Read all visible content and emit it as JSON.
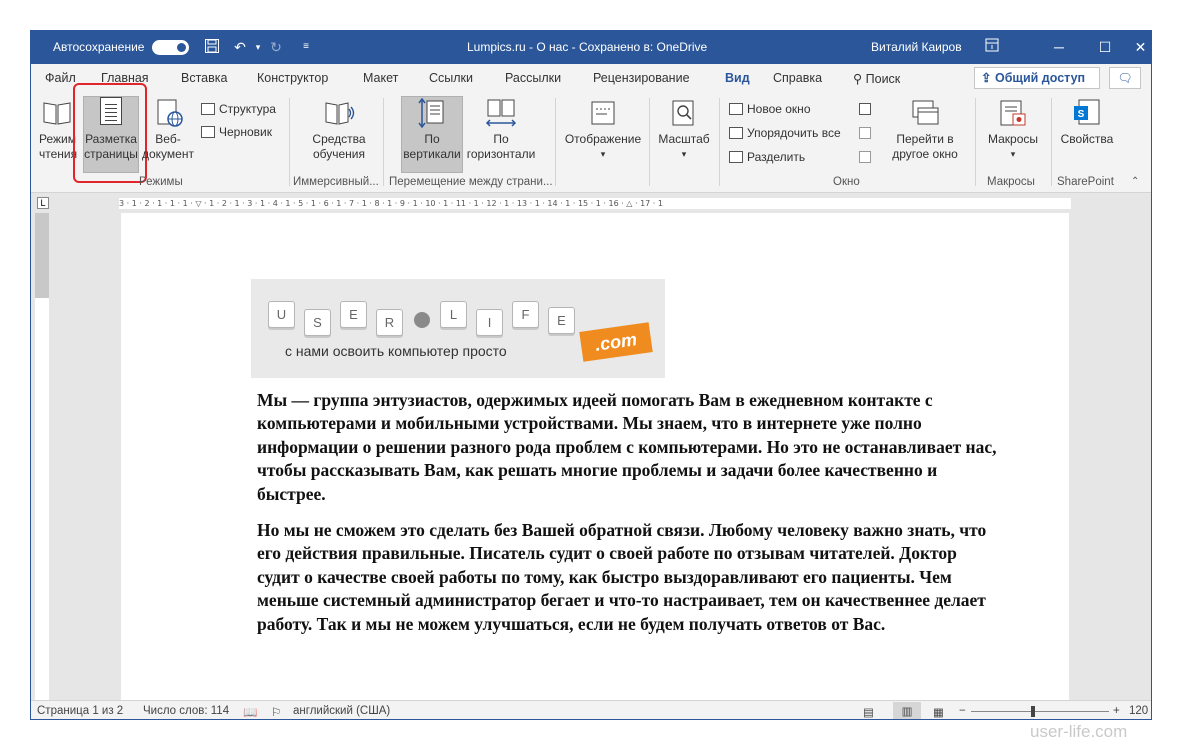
{
  "titlebar": {
    "autosave_label": "Автосохранение",
    "title": "Lumpics.ru - О нас - Сохранено в: OneDrive",
    "user": "Виталий Каиров",
    "controls": [
      "─",
      "☐",
      "✕"
    ]
  },
  "tabs": {
    "items": [
      "Файл",
      "Главная",
      "Вставка",
      "Конструктор",
      "Макет",
      "Ссылки",
      "Рассылки",
      "Рецензирование",
      "Вид",
      "Справка",
      "Поиск"
    ],
    "active": "Вид",
    "share_label": "Общий доступ"
  },
  "ribbon": {
    "modes": {
      "read_mode": "Режим чтения",
      "print_layout": "Разметка страницы",
      "web_layout": "Веб-документ",
      "outline": "Структура",
      "draft": "Черновик",
      "group_label": "Режимы"
    },
    "immersive": {
      "learning_tools": "Средства обучения",
      "group_label": "Иммерсивный..."
    },
    "page_movement": {
      "vertical": "По вертикали",
      "side_to_side": "По горизонтали",
      "group_label": "Перемещение между страни..."
    },
    "show": {
      "label": "Отображение"
    },
    "zoom": {
      "label": "Масштаб"
    },
    "window": {
      "new_window": "Новое окно",
      "arrange_all": "Упорядочить все",
      "split": "Разделить",
      "switch_windows": "Перейти в другое окно",
      "group_label": "Окно"
    },
    "macros": {
      "label": "Макросы",
      "group_label": "Макросы"
    },
    "sharepoint": {
      "label": "Свойства",
      "group_label": "SharePoint"
    }
  },
  "ruler": {
    "marks": "3 · 1 · 2 · 1 · 1 · 1 · ▽ · 1 · 2 · 1 · 3 · 1 · 4 · 1 · 5 · 1 · 6 · 1 · 7 · 1 · 8 · 1 · 9 · 1 · 10 · 1 · 11 · 1 · 12 · 1 · 13 · 1 · 14 · 1 · 15 · 1 · 16 · △ · 17 · 1"
  },
  "document": {
    "logo": {
      "keys": [
        "U",
        "S",
        "E",
        "R",
        "L",
        "I",
        "F",
        "E"
      ],
      "slogan": "с нами освоить компьютер просто",
      "domain": ".com"
    },
    "paragraph1": "Мы — группа энтузиастов, одержимых идеей помогать Вам в ежедневном контакте с компьютерами и мобильными устройствами. Мы знаем, что в интернете уже полно информации о решении разного рода проблем с компьютерами. Но это не останавливает нас, чтобы рассказывать Вам, как решать многие проблемы и задачи более качественно и быстрее.",
    "paragraph2": "Но мы не сможем это сделать без Вашей обратной связи. Любому человеку важно знать, что его действия правильные. Писатель судит о своей работе по отзывам читателей. Доктор судит о качестве своей работы по тому, как быстро выздоравливают его пациенты. Чем меньше системный администратор бегает и что-то настраивает, тем он качественнее делает работу. Так и мы не можем улучшаться, если не будем получать ответов от Вас."
  },
  "status": {
    "page": "Страница 1 из 2",
    "words": "Число слов: 114",
    "language": "английский (США)",
    "zoom": "120 %",
    "zoom_minus": "−",
    "zoom_plus": "+"
  },
  "watermark": "user-life.com"
}
